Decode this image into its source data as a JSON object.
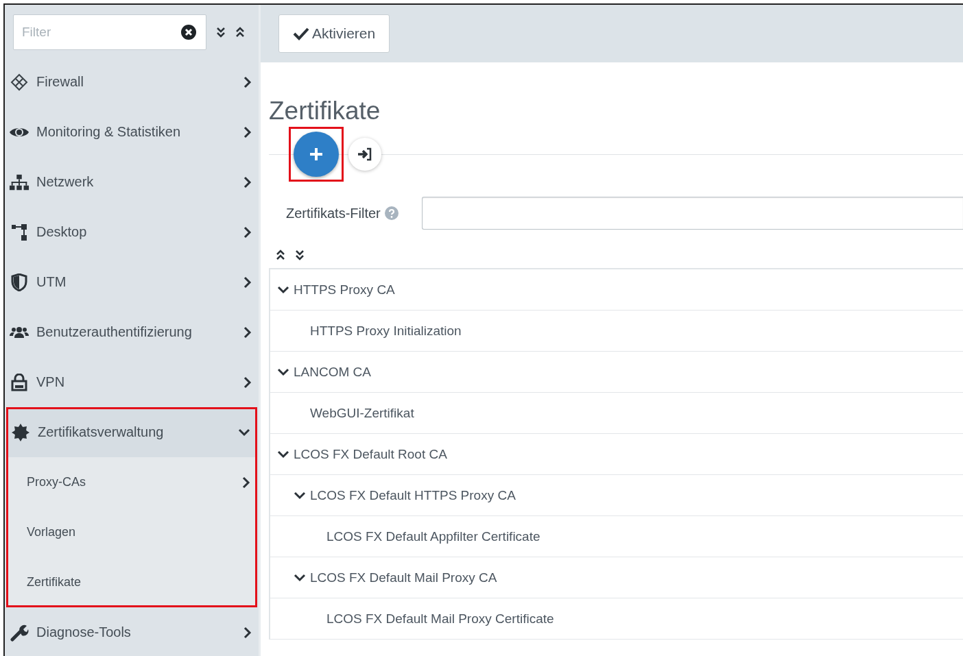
{
  "sidebar": {
    "filter": {
      "placeholder": "Filter"
    },
    "items": [
      {
        "label": "Firewall",
        "expanded": false,
        "highlighted": false
      },
      {
        "label": "Monitoring & Statistiken",
        "expanded": false,
        "highlighted": false
      },
      {
        "label": "Netzwerk",
        "expanded": false,
        "highlighted": false
      },
      {
        "label": "Desktop",
        "expanded": false,
        "highlighted": false
      },
      {
        "label": "UTM",
        "expanded": false,
        "highlighted": false
      },
      {
        "label": "Benutzerauthentifizierung",
        "expanded": false,
        "highlighted": false
      },
      {
        "label": "VPN",
        "expanded": false,
        "highlighted": false
      },
      {
        "label": "Zertifikatsverwaltung",
        "expanded": true,
        "highlighted": true,
        "children": [
          {
            "label": "Proxy-CAs",
            "expanded": false
          },
          {
            "label": "Vorlagen"
          },
          {
            "label": "Zertifikate"
          }
        ]
      },
      {
        "label": "Diagnose-Tools",
        "expanded": false,
        "highlighted": false
      }
    ]
  },
  "toolbar": {
    "activate_button": "Aktivieren"
  },
  "page": {
    "title": "Zertifikate",
    "add_button": {
      "highlighted": true
    },
    "filter_label": "Zertifikats-Filter",
    "tree": [
      {
        "label": "HTTPS Proxy CA",
        "expanded": true,
        "children": [
          {
            "label": "HTTPS Proxy Initialization"
          }
        ]
      },
      {
        "label": "LANCOM CA",
        "expanded": true,
        "children": [
          {
            "label": "WebGUI-Zertifikat"
          }
        ]
      },
      {
        "label": "LCOS FX Default Root CA",
        "expanded": true,
        "children": [
          {
            "label": "LCOS FX Default HTTPS Proxy CA",
            "expanded": true,
            "children": [
              {
                "label": "LCOS FX Default Appfilter Certificate"
              }
            ]
          },
          {
            "label": "LCOS FX Default Mail Proxy CA",
            "expanded": true,
            "children": [
              {
                "label": "LCOS FX Default Mail Proxy Certificate"
              }
            ]
          }
        ]
      }
    ]
  }
}
